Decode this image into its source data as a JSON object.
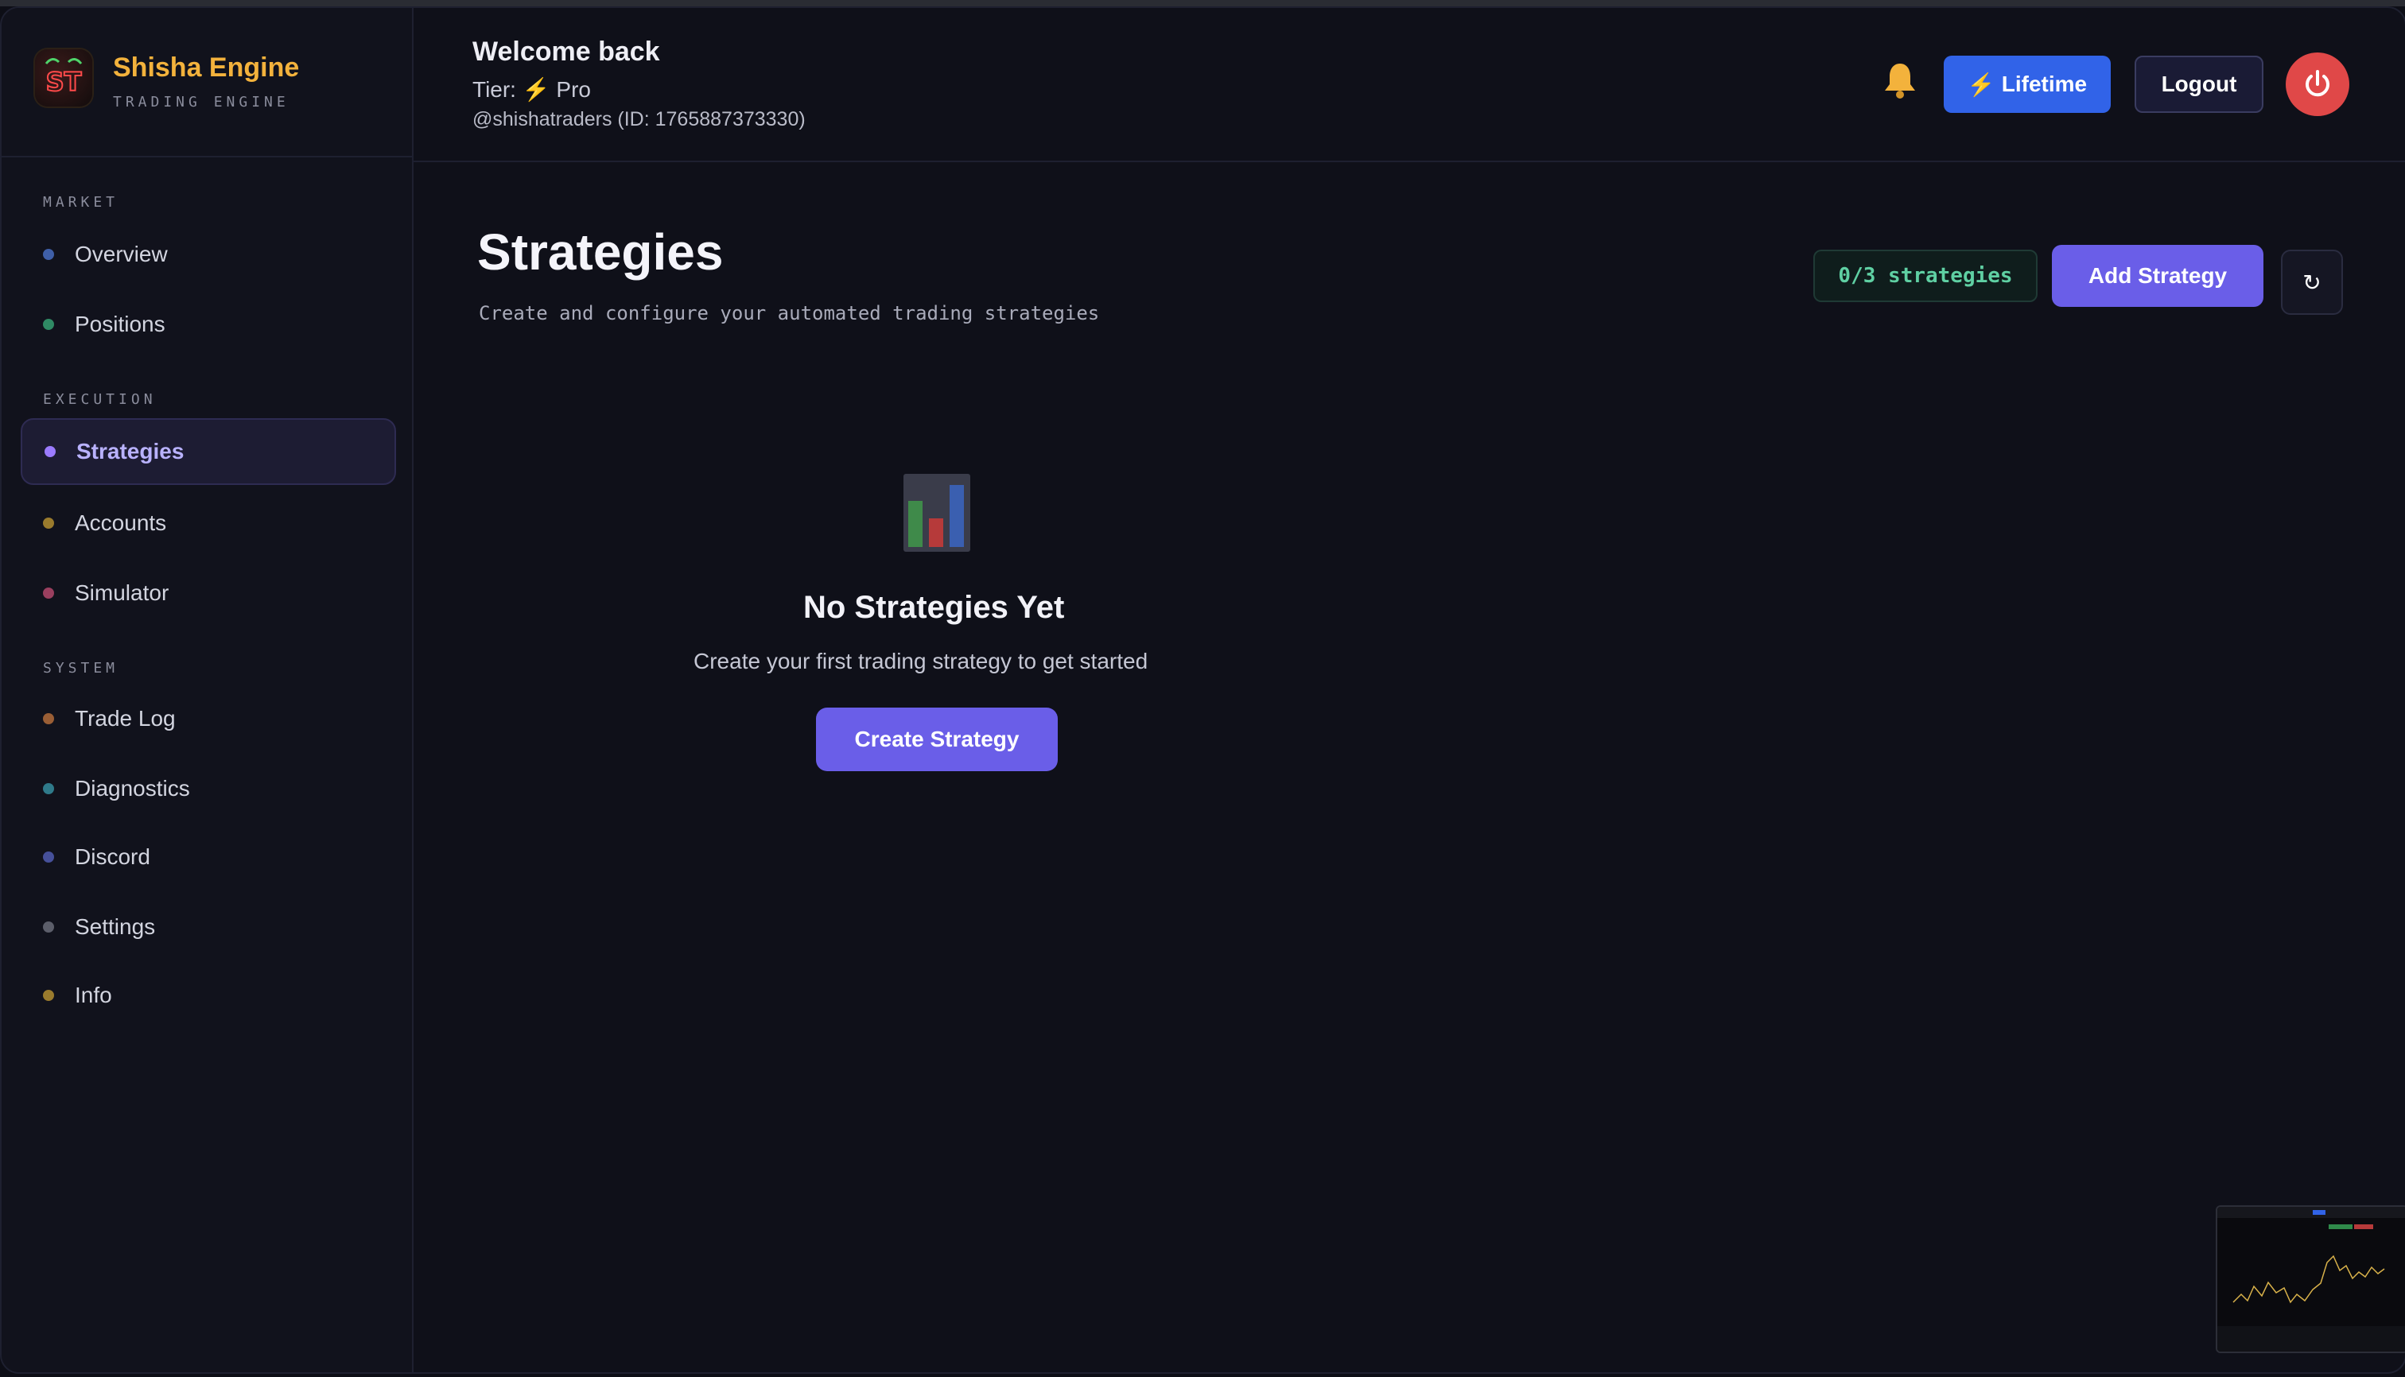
{
  "brand": {
    "name": "Shisha Engine",
    "subtitle": "TRADING ENGINE",
    "logo_text": "ST"
  },
  "sidebar": {
    "sections": [
      {
        "label": "MARKET",
        "items": [
          {
            "label": "Overview",
            "dot_color": "#3f5fa8"
          },
          {
            "label": "Positions",
            "dot_color": "#2f8a64"
          }
        ]
      },
      {
        "label": "EXECUTION",
        "items": [
          {
            "label": "Strategies",
            "dot_color": "#9b7bff",
            "active": true
          },
          {
            "label": "Accounts",
            "dot_color": "#9a7b2d"
          },
          {
            "label": "Simulator",
            "dot_color": "#9a3f5f"
          }
        ]
      },
      {
        "label": "SYSTEM",
        "items": [
          {
            "label": "Trade Log",
            "dot_color": "#9a5e35"
          },
          {
            "label": "Diagnostics",
            "dot_color": "#2f7a8a"
          },
          {
            "label": "Discord",
            "dot_color": "#46509a"
          },
          {
            "label": "Settings",
            "dot_color": "#5c5e6a"
          },
          {
            "label": "Info",
            "dot_color": "#9a7b2d"
          }
        ]
      }
    ]
  },
  "header": {
    "welcome": "Welcome back",
    "tier_prefix": "Tier:",
    "tier_icon": "⚡",
    "tier_name": "Pro",
    "handle": "@shishatraders (ID: 1765887373330)",
    "bell_icon": "bell-icon",
    "lifetime_icon": "⚡",
    "lifetime_label": "Lifetime",
    "logout_label": "Logout",
    "power_icon": "power-icon"
  },
  "main": {
    "title": "Strategies",
    "subtitle": "Create and configure your automated trading strategies",
    "count_badge": "0/3 strategies",
    "add_button": "Add Strategy",
    "refresh_icon": "↻",
    "empty_state": {
      "icon": "bar-chart-icon",
      "title": "No Strategies Yet",
      "subtitle": "Create your first trading strategy to get started",
      "button": "Create Strategy"
    }
  },
  "colors": {
    "accent": "#6a5ee8",
    "brand": "#f3b23c",
    "lifetime": "#3163e8",
    "power": "#e04848",
    "badge_text": "#5fd0a3"
  }
}
